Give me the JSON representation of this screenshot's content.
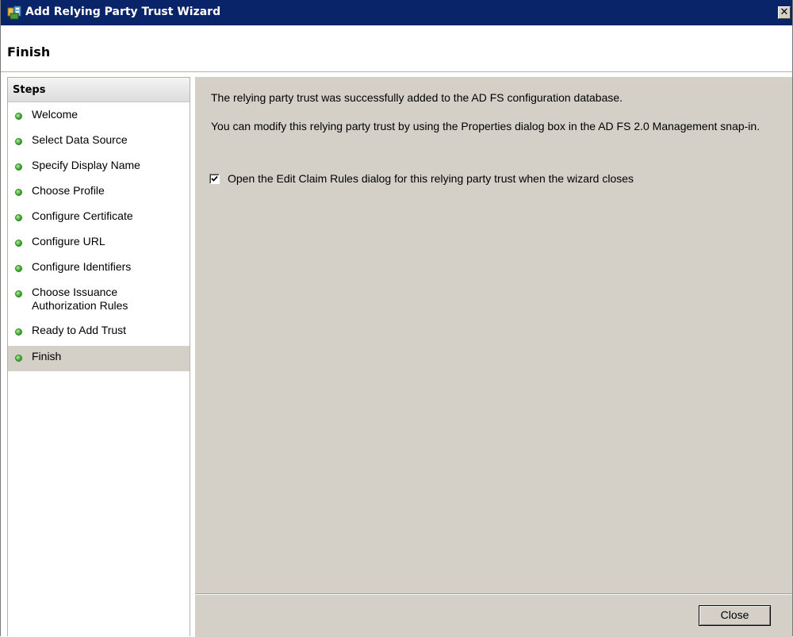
{
  "window": {
    "title": "Add Relying Party Trust Wizard",
    "close_glyph": "✕",
    "icon": "adfs-trust-icon"
  },
  "page": {
    "heading": "Finish"
  },
  "steps": {
    "header": "Steps",
    "items": [
      {
        "label": "Welcome"
      },
      {
        "label": "Select Data Source"
      },
      {
        "label": "Specify Display Name"
      },
      {
        "label": "Choose Profile"
      },
      {
        "label": "Configure Certificate"
      },
      {
        "label": "Configure URL"
      },
      {
        "label": "Configure Identifiers"
      },
      {
        "label": "Choose Issuance Authorization Rules"
      },
      {
        "label": "Ready to Add Trust"
      },
      {
        "label": "Finish"
      }
    ],
    "selected": "Finish",
    "status_color": "#3ca32c"
  },
  "content": {
    "message1": "The relying party trust was successfully added to the AD FS configuration database.",
    "message2": "You can modify this relying party trust by using the Properties dialog box in the AD FS 2.0 Management snap-in.",
    "checkbox_label": "Open the Edit Claim Rules dialog for this relying party trust when the wizard closes",
    "checkbox_checked": true
  },
  "footer": {
    "close_label": "Close"
  },
  "colors": {
    "titlebar": "#0a246a",
    "dialog_face": "#d4d0c8"
  }
}
